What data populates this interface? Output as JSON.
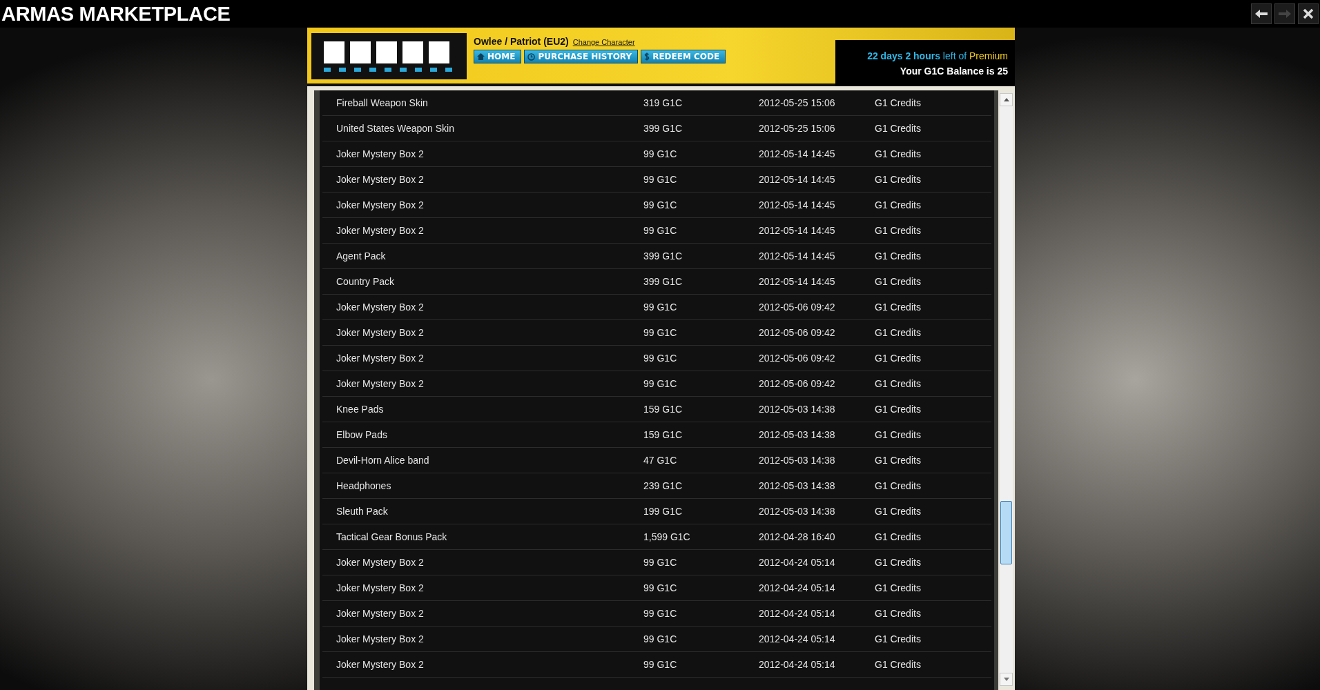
{
  "window": {
    "title": "ARMAS MARKETPLACE"
  },
  "window_buttons": [
    {
      "kind": "back",
      "disabled": false
    },
    {
      "kind": "forward",
      "disabled": true
    },
    {
      "kind": "close",
      "disabled": false
    }
  ],
  "header": {
    "character": "Owlee / Patriot (EU2)",
    "change_link": "Change Character",
    "nav": [
      {
        "kind": "home",
        "label": "HOME"
      },
      {
        "kind": "history",
        "label": "PURCHASE HISTORY"
      },
      {
        "kind": "redeem",
        "label": "REDEEM CODE"
      }
    ],
    "premium": {
      "time": "22 days 2 hours",
      "middle": "left of",
      "tier": "Premium"
    },
    "balance": "Your G1C Balance is 25"
  },
  "rows": [
    {
      "item": "Fireball Weapon Skin",
      "price": "319 G1C",
      "date": "2012-05-25 15:06",
      "payment": "G1 Credits"
    },
    {
      "item": "United States Weapon Skin",
      "price": "399 G1C",
      "date": "2012-05-25 15:06",
      "payment": "G1 Credits"
    },
    {
      "item": "Joker Mystery Box 2",
      "price": "99 G1C",
      "date": "2012-05-14 14:45",
      "payment": "G1 Credits"
    },
    {
      "item": "Joker Mystery Box 2",
      "price": "99 G1C",
      "date": "2012-05-14 14:45",
      "payment": "G1 Credits"
    },
    {
      "item": "Joker Mystery Box 2",
      "price": "99 G1C",
      "date": "2012-05-14 14:45",
      "payment": "G1 Credits"
    },
    {
      "item": "Joker Mystery Box 2",
      "price": "99 G1C",
      "date": "2012-05-14 14:45",
      "payment": "G1 Credits"
    },
    {
      "item": "Agent Pack",
      "price": "399 G1C",
      "date": "2012-05-14 14:45",
      "payment": "G1 Credits"
    },
    {
      "item": "Country Pack",
      "price": "399 G1C",
      "date": "2012-05-14 14:45",
      "payment": "G1 Credits"
    },
    {
      "item": "Joker Mystery Box 2",
      "price": "99 G1C",
      "date": "2012-05-06 09:42",
      "payment": "G1 Credits"
    },
    {
      "item": "Joker Mystery Box 2",
      "price": "99 G1C",
      "date": "2012-05-06 09:42",
      "payment": "G1 Credits"
    },
    {
      "item": "Joker Mystery Box 2",
      "price": "99 G1C",
      "date": "2012-05-06 09:42",
      "payment": "G1 Credits"
    },
    {
      "item": "Joker Mystery Box 2",
      "price": "99 G1C",
      "date": "2012-05-06 09:42",
      "payment": "G1 Credits"
    },
    {
      "item": "Knee Pads",
      "price": "159 G1C",
      "date": "2012-05-03 14:38",
      "payment": "G1 Credits"
    },
    {
      "item": "Elbow Pads",
      "price": "159 G1C",
      "date": "2012-05-03 14:38",
      "payment": "G1 Credits"
    },
    {
      "item": "Devil-Horn Alice band",
      "price": "47 G1C",
      "date": "2012-05-03 14:38",
      "payment": "G1 Credits"
    },
    {
      "item": "Headphones",
      "price": "239 G1C",
      "date": "2012-05-03 14:38",
      "payment": "G1 Credits"
    },
    {
      "item": "Sleuth Pack",
      "price": "199 G1C",
      "date": "2012-05-03 14:38",
      "payment": "G1 Credits"
    },
    {
      "item": "Tactical Gear Bonus Pack",
      "price": "1,599 G1C",
      "date": "2012-04-28 16:40",
      "payment": "G1 Credits"
    },
    {
      "item": "Joker Mystery Box 2",
      "price": "99 G1C",
      "date": "2012-04-24 05:14",
      "payment": "G1 Credits"
    },
    {
      "item": "Joker Mystery Box 2",
      "price": "99 G1C",
      "date": "2012-04-24 05:14",
      "payment": "G1 Credits"
    },
    {
      "item": "Joker Mystery Box 2",
      "price": "99 G1C",
      "date": "2012-04-24 05:14",
      "payment": "G1 Credits"
    },
    {
      "item": "Joker Mystery Box 2",
      "price": "99 G1C",
      "date": "2012-04-24 05:14",
      "payment": "G1 Credits"
    },
    {
      "item": "Joker Mystery Box 2",
      "price": "99 G1C",
      "date": "2012-04-24 05:14",
      "payment": "G1 Credits"
    }
  ]
}
